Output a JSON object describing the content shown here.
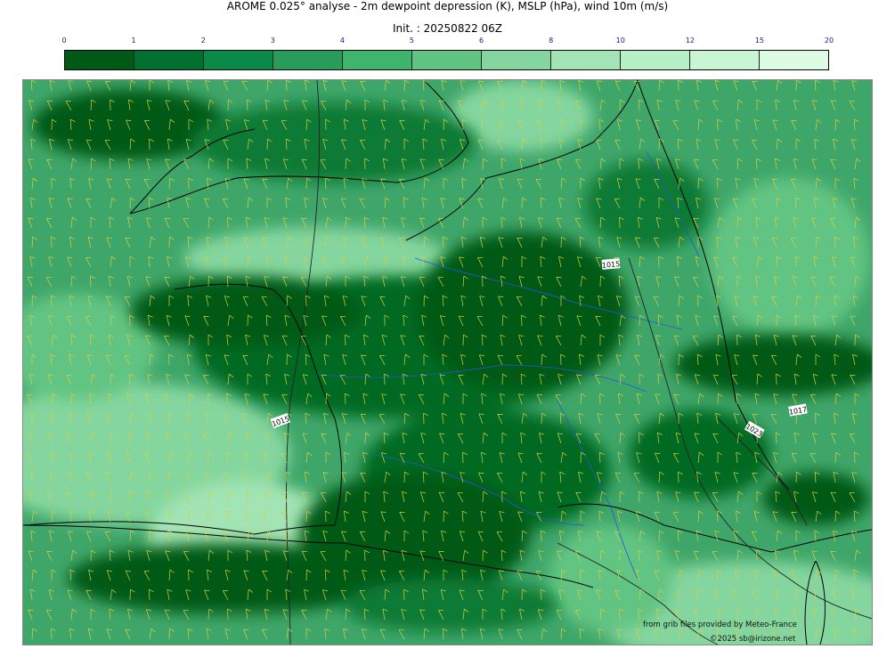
{
  "header": {
    "title": "AROME 0.025° analyse - 2m dewpoint depression (K), MSLP (hPa), wind 10m (m/s)",
    "init": "Init. : 20250822 06Z"
  },
  "colorbar": {
    "ticks": [
      "0",
      "1",
      "2",
      "3",
      "4",
      "5",
      "6",
      "8",
      "10",
      "12",
      "15",
      "20"
    ],
    "colors": [
      "#005a16",
      "#00702e",
      "#0a8a46",
      "#2a9c5a",
      "#3fb46c",
      "#62c482",
      "#84d69e",
      "#a2e4b4",
      "#b8f0c6",
      "#c8f6d4",
      "#dcfde4"
    ]
  },
  "map": {
    "isobar_labels": [
      "1015",
      "1015",
      "1017",
      "1023"
    ],
    "colors": {
      "coast": "#000000",
      "rivers": "#2457d6",
      "isobars": "#222222",
      "barbs": "#d8d040"
    }
  },
  "footer": {
    "source": "from grib files provided by Meteo-France",
    "copyright": "©2025 sb@irizone.net"
  }
}
